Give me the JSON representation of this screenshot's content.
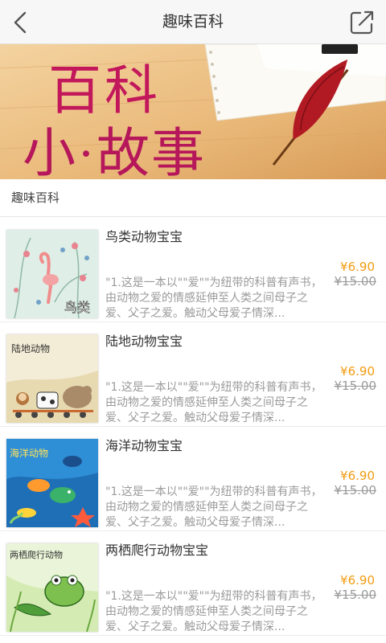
{
  "header": {
    "title": "趣味百科",
    "back_icon": "chevron-left-icon",
    "share_icon": "share-icon"
  },
  "banner": {
    "line1": "百科",
    "line2": "小·故事"
  },
  "section": {
    "title": "趣味百科"
  },
  "items": [
    {
      "title": "鸟类动物宝宝",
      "cover_text": "鸟类",
      "description": "\"1.这是一本以\"\"爱\"\"为纽带的科普有声书，由动物之爱的情感延伸至人类之间母子之爱、父子之爱。触动父母爱子情深...",
      "price": "¥6.90",
      "original_price": "¥15.00"
    },
    {
      "title": "陆地动物宝宝",
      "cover_text": "陆地动物",
      "description": "\"1.这是一本以\"\"爱\"\"为纽带的科普有声书，由动物之爱的情感延伸至人类之间母子之爱、父子之爱。触动父母爱子情深...",
      "price": "¥6.90",
      "original_price": "¥15.00"
    },
    {
      "title": "海洋动物宝宝",
      "cover_text": "海洋动物",
      "description": "\"1.这是一本以\"\"爱\"\"为纽带的科普有声书，由动物之爱的情感延伸至人类之间母子之爱、父子之爱。触动父母爱子情深...",
      "price": "¥6.90",
      "original_price": "¥15.00"
    },
    {
      "title": "两栖爬行动物宝宝",
      "cover_text": "两栖爬行动物",
      "description": "\"1.这是一本以\"\"爱\"\"为纽带的科普有声书，由动物之爱的情感延伸至人类之间母子之爱、父子之爱。触动父母爱子情深...",
      "price": "¥6.90",
      "original_price": "¥15.00"
    }
  ],
  "colors": {
    "price": "#f39c12",
    "banner_title": "#c2185b"
  }
}
